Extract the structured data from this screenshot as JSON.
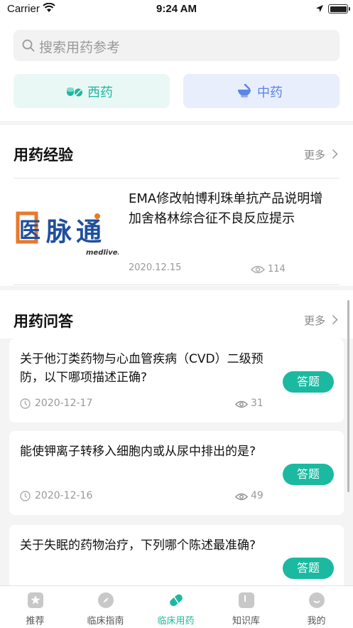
{
  "status_bar": {
    "carrier": "Carrier",
    "time": "9:24 AM"
  },
  "search": {
    "placeholder": "搜索用药参考"
  },
  "categories": [
    {
      "label": "西药",
      "icon": "pill-icon",
      "color": "#1bb9a0"
    },
    {
      "label": "中药",
      "icon": "mortar-icon",
      "color": "#5b86e5"
    }
  ],
  "experience": {
    "title": "用药经验",
    "more": "更多",
    "article": {
      "title": "EMA修改帕博利珠单抗产品说明增加舍格林综合征不良反应提示",
      "date": "2020.12.15",
      "views": "114",
      "logo_text": "医脉通",
      "logo_sub": "medlive.cn"
    }
  },
  "qa": {
    "title": "用药问答",
    "more": "更多",
    "answer_label": "答题",
    "items": [
      {
        "question": "关于他汀类药物与心血管疾病（CVD）二级预防，以下哪项描述正确?",
        "date": "2020-12-17",
        "views": "31"
      },
      {
        "question": "能使钾离子转移入细胞内或从尿中排出的是?",
        "date": "2020-12-16",
        "views": "49"
      },
      {
        "question": "关于失眠的药物治疗，下列哪个陈述最准确?",
        "date": "",
        "views": ""
      }
    ]
  },
  "tabbar": {
    "items": [
      {
        "label": "推荐",
        "icon": "star-icon"
      },
      {
        "label": "临床指南",
        "icon": "compass-icon"
      },
      {
        "label": "临床用药",
        "icon": "pill-icon"
      },
      {
        "label": "知识库",
        "icon": "book-icon"
      },
      {
        "label": "我的",
        "icon": "user-icon"
      }
    ],
    "active": "临床用药"
  },
  "colors": {
    "accent": "#1bb9a0",
    "chinese_med": "#5b86e5"
  }
}
